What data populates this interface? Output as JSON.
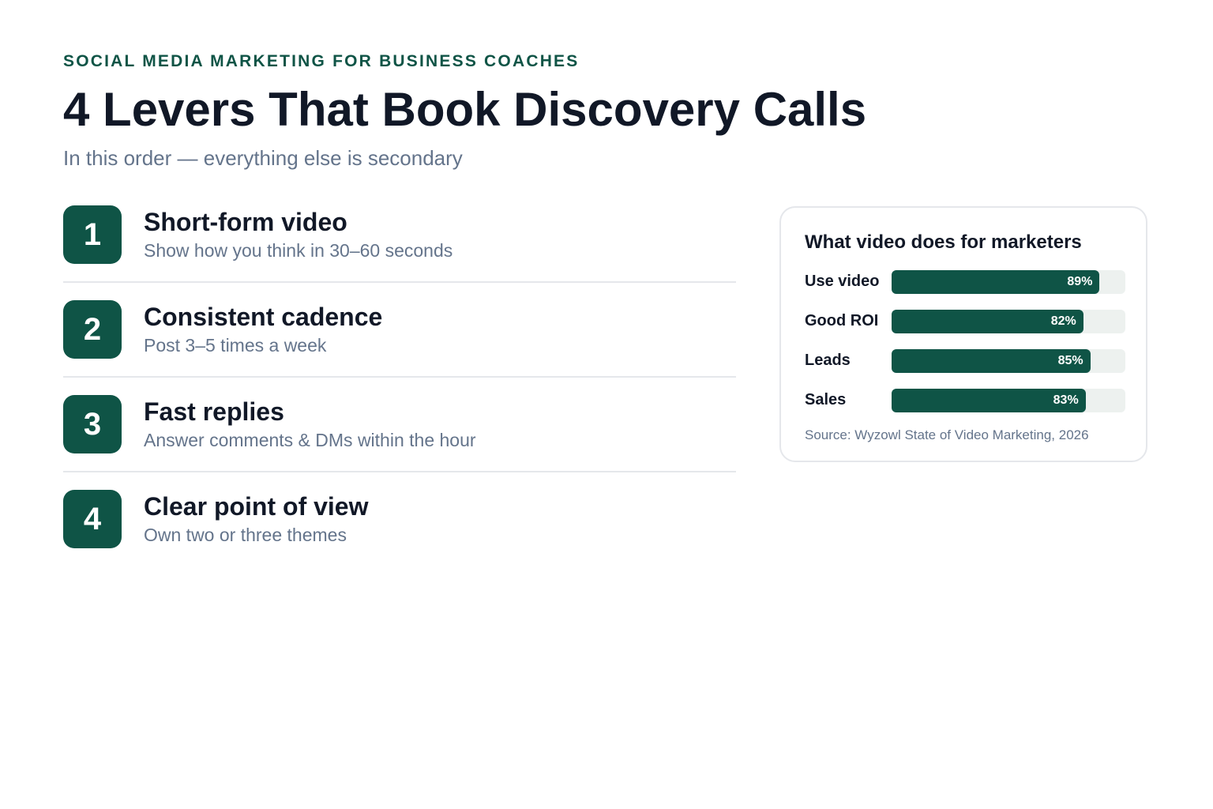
{
  "header": {
    "eyebrow": "SOCIAL MEDIA MARKETING FOR BUSINESS COACHES",
    "title": "4 Levers That Book Discovery Calls",
    "subtitle": "In this order — everything else is secondary"
  },
  "levers": [
    {
      "number": "1",
      "title": "Short-form video",
      "description": "Show how you think in 30–60 seconds"
    },
    {
      "number": "2",
      "title": "Consistent cadence",
      "description": "Post 3–5 times a week"
    },
    {
      "number": "3",
      "title": "Fast replies",
      "description": "Answer comments & DMs within the hour"
    },
    {
      "number": "4",
      "title": "Clear point of view",
      "description": "Own two or three themes"
    }
  ],
  "stats_card": {
    "title": "What video does for marketers",
    "source": "Source: Wyzowl State of Video Marketing, 2026"
  },
  "chart_data": {
    "type": "bar",
    "orientation": "horizontal",
    "title": "What video does for marketers",
    "categories": [
      "Use video",
      "Good ROI",
      "Leads",
      "Sales"
    ],
    "values": [
      89,
      82,
      85,
      83
    ],
    "value_labels": [
      "89%",
      "82%",
      "85%",
      "83%"
    ],
    "xlim": [
      0,
      100
    ],
    "grid": false,
    "colors": {
      "bar": "#0f5446",
      "track": "#edf1ef"
    }
  },
  "colors": {
    "accent": "#0f5446",
    "text": "#111827",
    "muted": "#64748b",
    "divider": "#e5e7eb"
  }
}
